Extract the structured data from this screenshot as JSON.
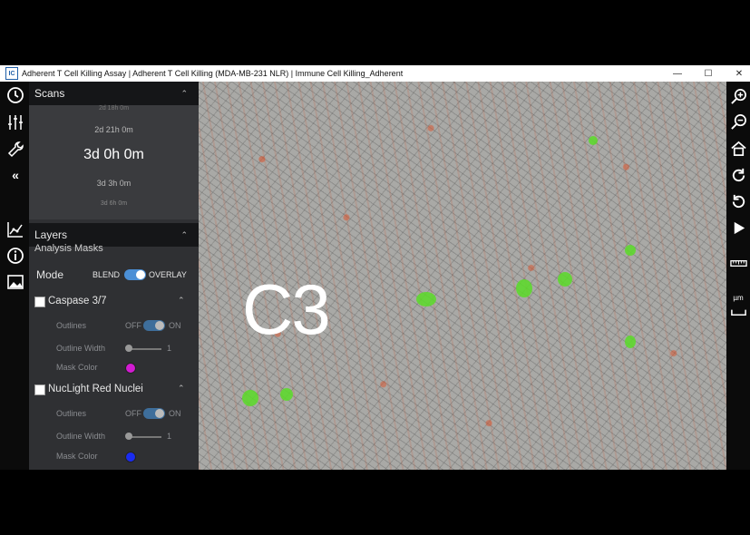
{
  "window": {
    "title": "Adherent T Cell Killing Assay | Adherent T Cell Killing (MDA-MB-231 NLR) | Immune Cell Killing_Adherent",
    "logo_text": "IC",
    "controls": {
      "minimize": "—",
      "maximize": "☐",
      "close": "✕"
    }
  },
  "left_rail": {
    "icons": [
      "clock-icon",
      "sliders-icon",
      "wrench-icon",
      "collapse-double-chevron-icon",
      "graph-icon",
      "info-icon",
      "image-icon"
    ],
    "collapse_glyph": "«"
  },
  "scans": {
    "title": "Scans",
    "times": [
      "2d 18h 0m",
      "2d 21h 0m",
      "3d 0h 0m",
      "3d 3h 0m",
      "3d 6h 0m"
    ],
    "selected_index": 2
  },
  "layers": {
    "title": "Layers",
    "analysis_masks_label": "Analysis Masks",
    "mode": {
      "label": "Mode",
      "left_option": "BLEND",
      "right_option": "OVERLAY",
      "value": "OVERLAY"
    },
    "items": [
      {
        "name": "Caspase 3/7",
        "checked": false,
        "outlines_label": "Outlines",
        "outlines_off": "OFF",
        "outlines_on": "ON",
        "outline_width_label": "Outline Width",
        "outline_width_value": "1",
        "mask_color_label": "Mask Color",
        "mask_color": "#d21bd2"
      },
      {
        "name": "NucLight Red Nuclei",
        "checked": false,
        "outlines_label": "Outlines",
        "outlines_off": "OFF",
        "outlines_on": "ON",
        "outline_width_label": "Outline Width",
        "outline_width_value": "1",
        "mask_color_label": "Mask Color",
        "mask_color": "#1a2cf0"
      }
    ]
  },
  "viewer": {
    "well_label": "C3"
  },
  "right_rail": {
    "icons": [
      "zoom-in-icon",
      "zoom-out-icon",
      "home-icon",
      "rotate-forward-icon",
      "rotate-back-icon",
      "play-icon",
      "ruler-icon",
      "scale-bar-icon"
    ],
    "unit_label": "µm"
  }
}
